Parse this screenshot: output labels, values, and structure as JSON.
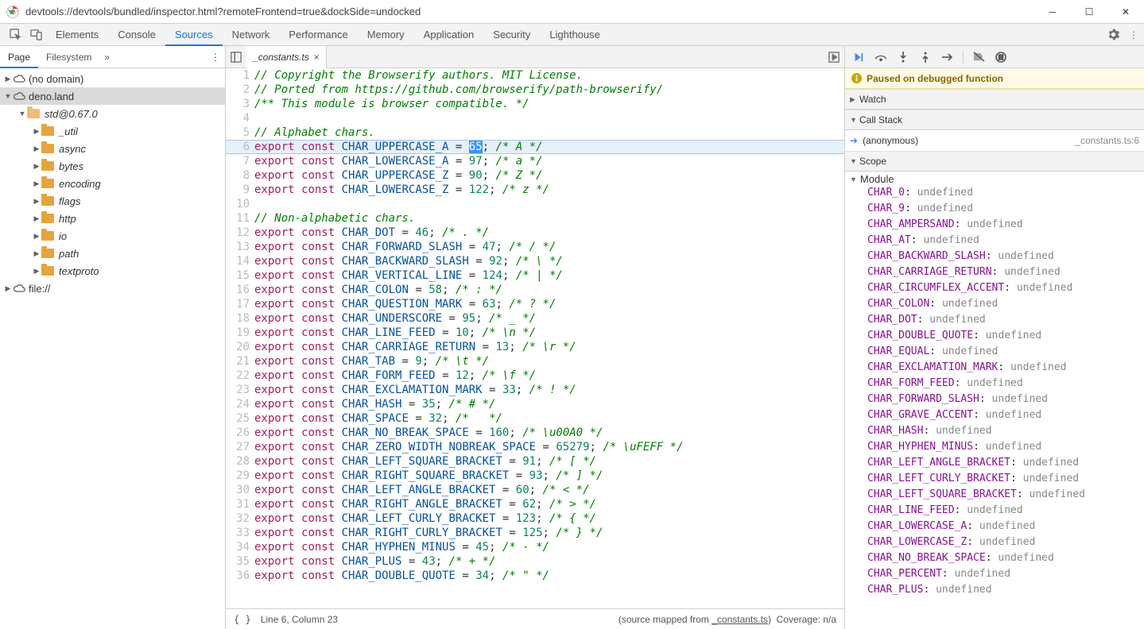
{
  "window": {
    "url": "devtools://devtools/bundled/inspector.html?remoteFrontend=true&dockSide=undocked"
  },
  "tabs": [
    "Elements",
    "Console",
    "Sources",
    "Network",
    "Performance",
    "Memory",
    "Application",
    "Security",
    "Lighthouse"
  ],
  "active_tab": "Sources",
  "left": {
    "subtabs": [
      "Page",
      "Filesystem"
    ],
    "active_subtab": "Page",
    "tree": [
      {
        "kind": "cloud",
        "label": "(no domain)",
        "indent": 0,
        "arrow": "▶"
      },
      {
        "kind": "cloud",
        "label": "deno.land",
        "indent": 0,
        "arrow": "▼",
        "sel": true
      },
      {
        "kind": "folder",
        "label": "std@0.67.0",
        "indent": 1,
        "arrow": "▼",
        "faint": true
      },
      {
        "kind": "folder",
        "label": "_util",
        "indent": 2,
        "arrow": "▶"
      },
      {
        "kind": "folder",
        "label": "async",
        "indent": 2,
        "arrow": "▶"
      },
      {
        "kind": "folder",
        "label": "bytes",
        "indent": 2,
        "arrow": "▶"
      },
      {
        "kind": "folder",
        "label": "encoding",
        "indent": 2,
        "arrow": "▶"
      },
      {
        "kind": "folder",
        "label": "flags",
        "indent": 2,
        "arrow": "▶"
      },
      {
        "kind": "folder",
        "label": "http",
        "indent": 2,
        "arrow": "▶"
      },
      {
        "kind": "folder",
        "label": "io",
        "indent": 2,
        "arrow": "▶"
      },
      {
        "kind": "folder",
        "label": "path",
        "indent": 2,
        "arrow": "▶"
      },
      {
        "kind": "folder",
        "label": "textproto",
        "indent": 2,
        "arrow": "▶"
      },
      {
        "kind": "cloud",
        "label": "file://",
        "indent": 0,
        "arrow": "▶"
      }
    ]
  },
  "mid": {
    "open_file": "_constants.ts",
    "highlight_line": 6,
    "code": [
      {
        "n": 1,
        "t": "comment",
        "text": "// Copyright the Browserify authors. MIT License."
      },
      {
        "n": 2,
        "t": "comment",
        "text": "// Ported from https://github.com/browserify/path-browserify/"
      },
      {
        "n": 3,
        "t": "comment",
        "text": "/** This module is browser compatible. */"
      },
      {
        "n": 4,
        "t": "blank",
        "text": ""
      },
      {
        "n": 5,
        "t": "comment",
        "text": "// Alphabet chars."
      },
      {
        "n": 6,
        "t": "const",
        "name": "CHAR_UPPERCASE_A",
        "val": "65",
        "c": "/* A */",
        "sel": true
      },
      {
        "n": 7,
        "t": "const",
        "name": "CHAR_LOWERCASE_A",
        "val": "97",
        "c": "/* a */"
      },
      {
        "n": 8,
        "t": "const",
        "name": "CHAR_UPPERCASE_Z",
        "val": "90",
        "c": "/* Z */"
      },
      {
        "n": 9,
        "t": "const",
        "name": "CHAR_LOWERCASE_Z",
        "val": "122",
        "c": "/* z */"
      },
      {
        "n": 10,
        "t": "blank",
        "text": ""
      },
      {
        "n": 11,
        "t": "comment",
        "text": "// Non-alphabetic chars."
      },
      {
        "n": 12,
        "t": "const",
        "name": "CHAR_DOT",
        "val": "46",
        "c": "/* . */"
      },
      {
        "n": 13,
        "t": "const",
        "name": "CHAR_FORWARD_SLASH",
        "val": "47",
        "c": "/* / */"
      },
      {
        "n": 14,
        "t": "const",
        "name": "CHAR_BACKWARD_SLASH",
        "val": "92",
        "c": "/* \\ */"
      },
      {
        "n": 15,
        "t": "const",
        "name": "CHAR_VERTICAL_LINE",
        "val": "124",
        "c": "/* | */"
      },
      {
        "n": 16,
        "t": "const",
        "name": "CHAR_COLON",
        "val": "58",
        "c": "/* : */"
      },
      {
        "n": 17,
        "t": "const",
        "name": "CHAR_QUESTION_MARK",
        "val": "63",
        "c": "/* ? */"
      },
      {
        "n": 18,
        "t": "const",
        "name": "CHAR_UNDERSCORE",
        "val": "95",
        "c": "/* _ */"
      },
      {
        "n": 19,
        "t": "const",
        "name": "CHAR_LINE_FEED",
        "val": "10",
        "c": "/* \\n */"
      },
      {
        "n": 20,
        "t": "const",
        "name": "CHAR_CARRIAGE_RETURN",
        "val": "13",
        "c": "/* \\r */"
      },
      {
        "n": 21,
        "t": "const",
        "name": "CHAR_TAB",
        "val": "9",
        "c": "/* \\t */"
      },
      {
        "n": 22,
        "t": "const",
        "name": "CHAR_FORM_FEED",
        "val": "12",
        "c": "/* \\f */"
      },
      {
        "n": 23,
        "t": "const",
        "name": "CHAR_EXCLAMATION_MARK",
        "val": "33",
        "c": "/* ! */"
      },
      {
        "n": 24,
        "t": "const",
        "name": "CHAR_HASH",
        "val": "35",
        "c": "/* # */"
      },
      {
        "n": 25,
        "t": "const",
        "name": "CHAR_SPACE",
        "val": "32",
        "c": "/*   */"
      },
      {
        "n": 26,
        "t": "const",
        "name": "CHAR_NO_BREAK_SPACE",
        "val": "160",
        "c": "/* \\u00A0 */"
      },
      {
        "n": 27,
        "t": "const",
        "name": "CHAR_ZERO_WIDTH_NOBREAK_SPACE",
        "val": "65279",
        "c": "/* \\uFEFF */"
      },
      {
        "n": 28,
        "t": "const",
        "name": "CHAR_LEFT_SQUARE_BRACKET",
        "val": "91",
        "c": "/* [ */"
      },
      {
        "n": 29,
        "t": "const",
        "name": "CHAR_RIGHT_SQUARE_BRACKET",
        "val": "93",
        "c": "/* ] */"
      },
      {
        "n": 30,
        "t": "const",
        "name": "CHAR_LEFT_ANGLE_BRACKET",
        "val": "60",
        "c": "/* < */"
      },
      {
        "n": 31,
        "t": "const",
        "name": "CHAR_RIGHT_ANGLE_BRACKET",
        "val": "62",
        "c": "/* > */"
      },
      {
        "n": 32,
        "t": "const",
        "name": "CHAR_LEFT_CURLY_BRACKET",
        "val": "123",
        "c": "/* { */"
      },
      {
        "n": 33,
        "t": "const",
        "name": "CHAR_RIGHT_CURLY_BRACKET",
        "val": "125",
        "c": "/* } */"
      },
      {
        "n": 34,
        "t": "const",
        "name": "CHAR_HYPHEN_MINUS",
        "val": "45",
        "c": "/* - */"
      },
      {
        "n": 35,
        "t": "const",
        "name": "CHAR_PLUS",
        "val": "43",
        "c": "/* + */"
      },
      {
        "n": 36,
        "t": "const",
        "name": "CHAR_DOUBLE_QUOTE",
        "val": "34",
        "c": "/* \" */"
      }
    ],
    "status": {
      "cursor": "Line 6, Column 23",
      "mapped_prefix": "(source mapped from ",
      "mapped_file": "_constants.ts",
      "mapped_suffix": ")",
      "coverage": "Coverage: n/a"
    }
  },
  "right": {
    "banner": "Paused on debugged function",
    "sections": {
      "watch": "Watch",
      "callstack": "Call Stack",
      "scope": "Scope"
    },
    "call": {
      "name": "(anonymous)",
      "loc": "_constants.ts:6"
    },
    "scope_group": "Module",
    "vars": [
      "CHAR_0",
      "CHAR_9",
      "CHAR_AMPERSAND",
      "CHAR_AT",
      "CHAR_BACKWARD_SLASH",
      "CHAR_CARRIAGE_RETURN",
      "CHAR_CIRCUMFLEX_ACCENT",
      "CHAR_COLON",
      "CHAR_DOT",
      "CHAR_DOUBLE_QUOTE",
      "CHAR_EQUAL",
      "CHAR_EXCLAMATION_MARK",
      "CHAR_FORM_FEED",
      "CHAR_FORWARD_SLASH",
      "CHAR_GRAVE_ACCENT",
      "CHAR_HASH",
      "CHAR_HYPHEN_MINUS",
      "CHAR_LEFT_ANGLE_BRACKET",
      "CHAR_LEFT_CURLY_BRACKET",
      "CHAR_LEFT_SQUARE_BRACKET",
      "CHAR_LINE_FEED",
      "CHAR_LOWERCASE_A",
      "CHAR_LOWERCASE_Z",
      "CHAR_NO_BREAK_SPACE",
      "CHAR_PERCENT",
      "CHAR_PLUS"
    ],
    "var_value": "undefined"
  }
}
